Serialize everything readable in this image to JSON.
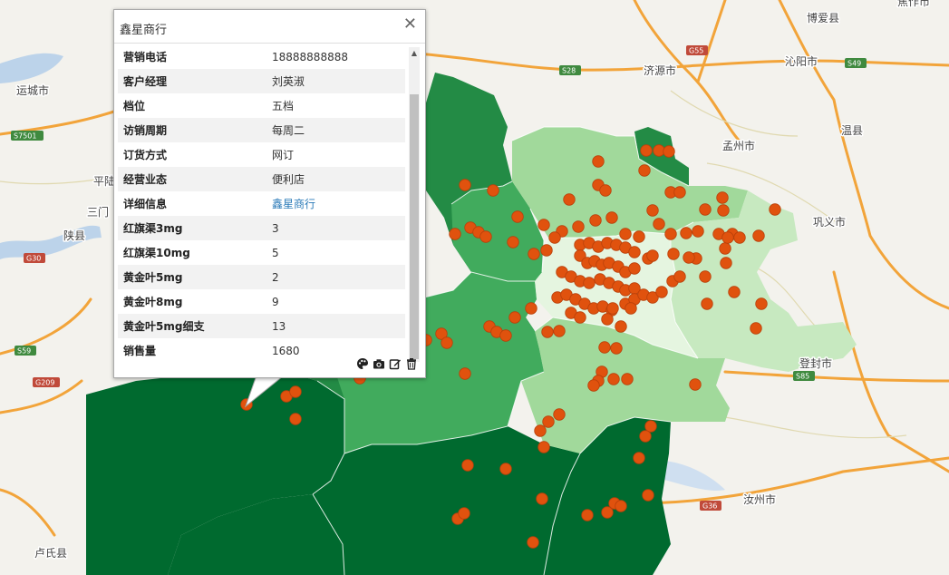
{
  "map": {
    "city_labels": [
      {
        "name": "运城市"
      },
      {
        "name": "济源市"
      },
      {
        "name": "沁阳市"
      },
      {
        "name": "博爱县"
      },
      {
        "name": "温县"
      },
      {
        "name": "孟州市"
      },
      {
        "name": "巩义市"
      },
      {
        "name": "登封市"
      },
      {
        "name": "汝州市"
      },
      {
        "name": "卢氏县"
      },
      {
        "name": "陕县"
      },
      {
        "name": "平陆"
      },
      {
        "name": "三门"
      },
      {
        "name": "焦作市"
      }
    ],
    "road_shields": [
      "S7501",
      "G30",
      "S28",
      "G55",
      "S49",
      "S59",
      "G209",
      "S85",
      "G36"
    ],
    "colors": {
      "darkest": "#006a2f",
      "dark": "#238b45",
      "medium": "#41ab5d",
      "light": "#a1d99b",
      "lightest": "#e5f5e0",
      "point": "#e0520e"
    }
  },
  "popup": {
    "title": "鑫星商行",
    "close_symbol": "✕",
    "rows": [
      {
        "key": "营销电话",
        "value": "18888888888"
      },
      {
        "key": "客户经理",
        "value": "刘英淑"
      },
      {
        "key": "档位",
        "value": "五档"
      },
      {
        "key": "访销周期",
        "value": "每周二"
      },
      {
        "key": "订货方式",
        "value": "网订"
      },
      {
        "key": "经营业态",
        "value": "便利店"
      },
      {
        "key": "详细信息",
        "value": "鑫星商行"
      },
      {
        "key": "红旗渠3mg",
        "value": "3"
      },
      {
        "key": "红旗渠10mg",
        "value": "5"
      },
      {
        "key": "黄金叶5mg",
        "value": "2"
      },
      {
        "key": "黄金叶8mg",
        "value": "9"
      },
      {
        "key": "黄金叶5mg细支",
        "value": "13"
      },
      {
        "key": "销售量",
        "value": "1680"
      }
    ],
    "tools": [
      "palette-icon",
      "camera-icon",
      "edit-icon",
      "trash-icon"
    ]
  }
}
